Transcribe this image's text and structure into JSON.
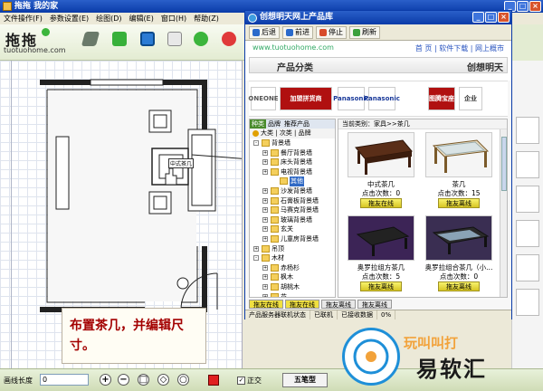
{
  "app": {
    "title": "拖拖 我的家",
    "menu": [
      "文件操作(F)",
      "参数设置(E)",
      "绘图(D)",
      "编辑(E)",
      "窗口(H)",
      "帮助(Z)"
    ],
    "logo_site": "tuotuohome.com",
    "logo_mark": "拖拖"
  },
  "floorplan": {
    "furniture_label": "中式茶几"
  },
  "note": {
    "text": "布置茶几，并编辑尺寸。"
  },
  "store": {
    "title": "创想明天网上产品库",
    "nav": {
      "back": "后退",
      "forward": "前进",
      "stop": "停止",
      "refresh": "刷新"
    },
    "site": "www.tuotuohome.com",
    "links": "首 页 | 软件下载 | 网上概市",
    "category_title": "产品分类",
    "brand_title": "创想明天",
    "brands": [
      "ONEONE",
      "加盟拼货商",
      "Panasonic",
      "Panasonic",
      "图腾宝座",
      "企业"
    ],
    "tree_tabs": [
      "种类",
      "品牌",
      "推荐产品"
    ],
    "tree_head": [
      "大类",
      "次类",
      "品牌"
    ],
    "tree": [
      {
        "label": "背景墙",
        "level": 0,
        "expand": "-"
      },
      {
        "label": "餐厅背景墙",
        "level": 1,
        "expand": "+"
      },
      {
        "label": "床头背景墙",
        "level": 1,
        "expand": "+"
      },
      {
        "label": "电视背景墙",
        "level": 1,
        "expand": "+"
      },
      {
        "label": "其他",
        "level": 2,
        "expand": ""
      },
      {
        "label": "沙发背景墙",
        "level": 1,
        "expand": "+"
      },
      {
        "label": "石膏板背景墙",
        "level": 1,
        "expand": "+"
      },
      {
        "label": "马赛克背景墙",
        "level": 1,
        "expand": "+"
      },
      {
        "label": "玻璃背景墙",
        "level": 1,
        "expand": "+"
      },
      {
        "label": "玄关",
        "level": 1,
        "expand": "+"
      },
      {
        "label": "儿童房背景墙",
        "level": 1,
        "expand": "+"
      },
      {
        "label": "吊顶",
        "level": 0,
        "expand": "+"
      },
      {
        "label": "木材",
        "level": 0,
        "expand": "-"
      },
      {
        "label": "赤杨杉",
        "level": 1,
        "expand": "+"
      },
      {
        "label": "枫木",
        "level": 1,
        "expand": "+"
      },
      {
        "label": "胡桃木",
        "level": 1,
        "expand": "+"
      },
      {
        "label": "花...",
        "level": 1,
        "expand": "+"
      }
    ],
    "breadcrumb": "当前类别：家具>>茶几",
    "products": [
      {
        "name": "中式茶几",
        "hits": "点击次数：0",
        "button": "拖友在线"
      },
      {
        "name": "茶几",
        "hits": "点击次数：15",
        "button": "拖友离线"
      },
      {
        "name": "奥罗拉组方茶几",
        "hits": "点击次数：5",
        "button": "拖友离线"
      },
      {
        "name": "奥罗拉组合茶几（小...",
        "hits": "点击次数：0",
        "button": "拖友离线"
      }
    ],
    "bottom_tabs": [
      "拖友在线",
      "拖友在线",
      "拖友离线",
      "拖友离线"
    ],
    "status": [
      "产品服务器联机状态",
      "已联机",
      "已接收数据",
      "0%"
    ]
  },
  "bottom": {
    "wall_label": "画线长度",
    "wall_value": "0",
    "ortho_label": "正交",
    "ime_label": "五笔型"
  },
  "watermark": {
    "text": "易软汇",
    "orange": "玩叫叫打"
  },
  "colors": {
    "titlebar": "#0a3ba8",
    "accent_green": "#4a8b2c",
    "note_text": "#a30000",
    "watermark_blue": "#1e8fd8"
  }
}
